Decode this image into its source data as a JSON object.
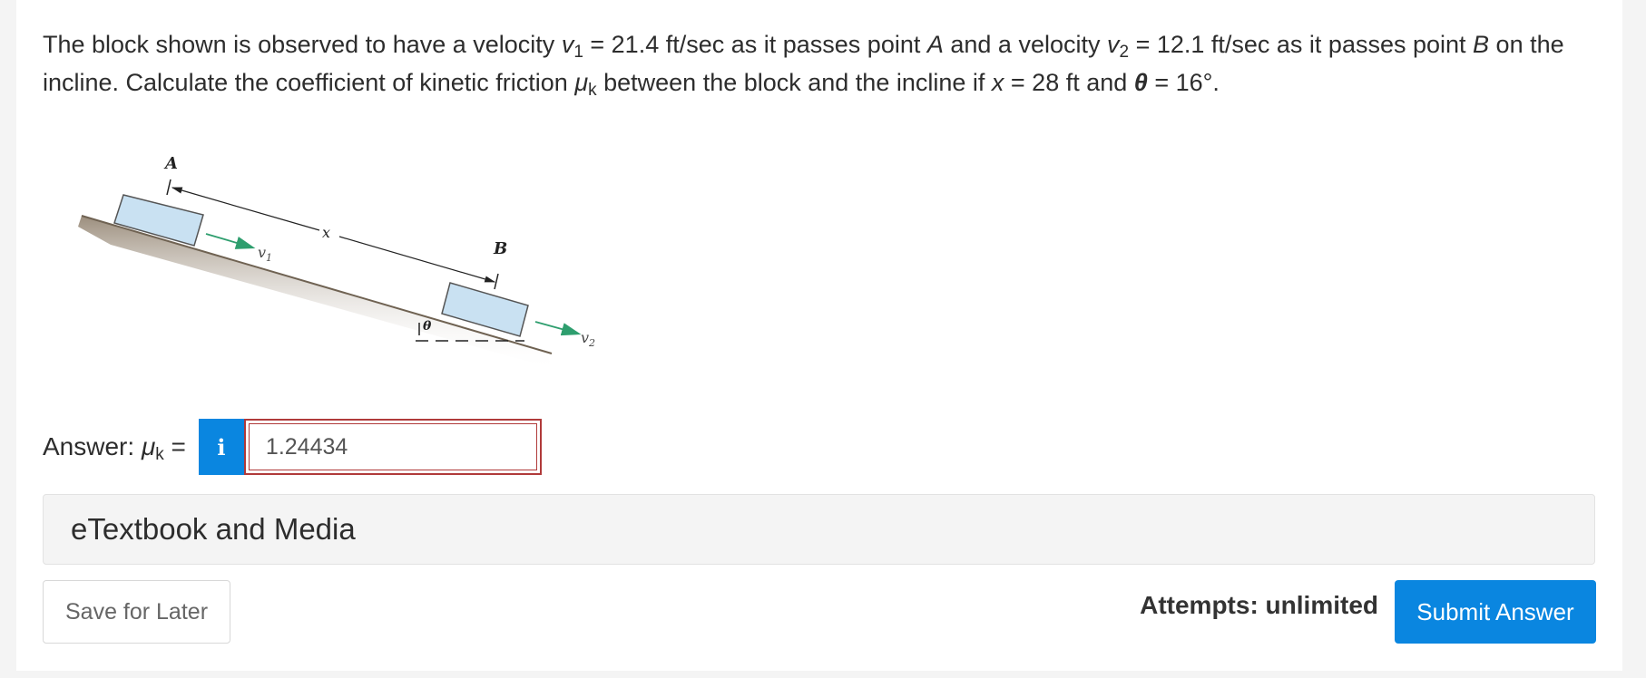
{
  "question": {
    "p1": "The block shown is observed to have a velocity ",
    "v1_sym": "v",
    "v1_sub": "1",
    "p2": " = 21.4 ft/sec as it passes point ",
    "pointA": "A",
    "p3": " and a velocity ",
    "v2_sym": "v",
    "v2_sub": "2",
    "p4": " = 12.1 ft/sec as it passes point ",
    "pointB": "B",
    "p5": " on the incline. Calculate the coefficient of kinetic friction ",
    "mu_sym": "μ",
    "mu_sub": "k",
    "p6": " between the block and the incline if ",
    "x_sym": "x",
    "p7": " = 28 ft and ",
    "theta_sym": "θ",
    "p8": " = 16°."
  },
  "figure": {
    "label_A": "A",
    "label_B": "B",
    "label_x": "x",
    "label_v1": "v",
    "label_v1_sub": "1",
    "label_v2": "v",
    "label_v2_sub": "2",
    "label_theta": "θ",
    "block_color": "#c9e1f2",
    "ground_color": "#8a7a66",
    "arrow_color": "#2e9e6e"
  },
  "answer": {
    "label_prefix": "Answer: ",
    "mu_sym": "μ",
    "mu_sub": "k",
    "equals": " =",
    "info_icon": "i",
    "value": "1.24434"
  },
  "etextbook": {
    "label": "eTextbook and Media"
  },
  "footer": {
    "save_label": "Save for Later",
    "attempts_label": "Attempts: unlimited",
    "submit_label": "Submit Answer"
  },
  "colors": {
    "accent": "#0a86e0",
    "error_border": "#b03a3a"
  }
}
